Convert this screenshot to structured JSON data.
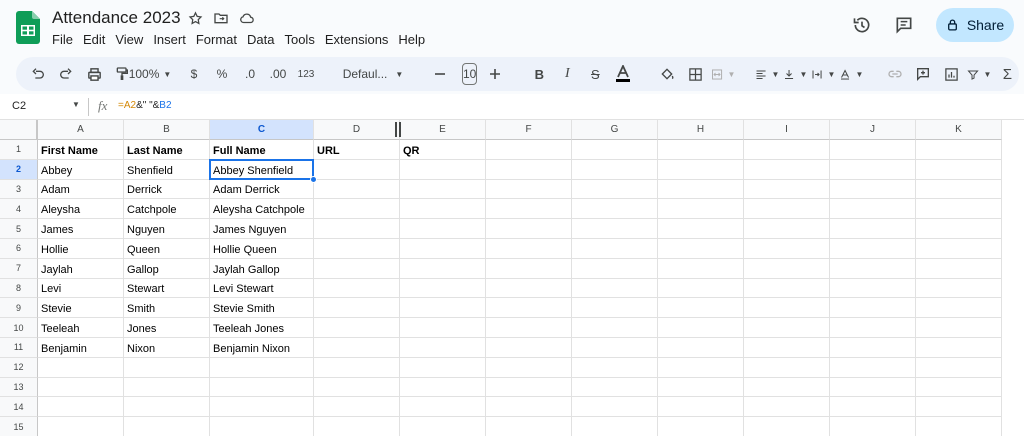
{
  "header": {
    "title": "Attendance 2023",
    "menu": [
      "File",
      "Edit",
      "View",
      "Insert",
      "Format",
      "Data",
      "Tools",
      "Extensions",
      "Help"
    ],
    "share_label": "Share"
  },
  "toolbar": {
    "zoom": "100%",
    "currency": "$",
    "percent": "%",
    "decrease_decimals": ".0",
    "increase_decimals": ".00",
    "number_format": "123",
    "font": "Defaul...",
    "font_size": "10"
  },
  "formula_bar": {
    "name_box": "C2",
    "fx": "fx",
    "formula_ref1": "=A2",
    "formula_mid": "&\"  \"&",
    "formula_ref2": "B2"
  },
  "sheet": {
    "columns": [
      "A",
      "B",
      "C",
      "D",
      "E",
      "F",
      "G",
      "H",
      "I",
      "J",
      "K"
    ],
    "rows": [
      "1",
      "2",
      "3",
      "4",
      "5",
      "6",
      "7",
      "8",
      "9",
      "10",
      "11",
      "12",
      "13",
      "14",
      "15"
    ],
    "selected_cell": "C2",
    "data": [
      [
        "First Name",
        "Last Name",
        "Full Name",
        "URL",
        "QR"
      ],
      [
        "Abbey",
        "Shenfield",
        "Abbey Shenfield",
        "",
        ""
      ],
      [
        "Adam",
        "Derrick",
        "Adam Derrick",
        "",
        ""
      ],
      [
        "Aleysha",
        "Catchpole",
        "Aleysha Catchpole",
        "",
        ""
      ],
      [
        "James",
        "Nguyen",
        "James Nguyen",
        "",
        ""
      ],
      [
        "Hollie",
        "Queen",
        "Hollie Queen",
        "",
        ""
      ],
      [
        "Jaylah",
        "Gallop",
        "Jaylah Gallop",
        "",
        ""
      ],
      [
        "Levi",
        "Stewart",
        "Levi Stewart",
        "",
        ""
      ],
      [
        "Stevie",
        "Smith",
        "Stevie Smith",
        "",
        ""
      ],
      [
        "Teeleah",
        "Jones",
        "Teeleah Jones",
        "",
        ""
      ],
      [
        "Benjamin",
        "Nixon",
        "Benjamin Nixon",
        "",
        ""
      ]
    ]
  }
}
